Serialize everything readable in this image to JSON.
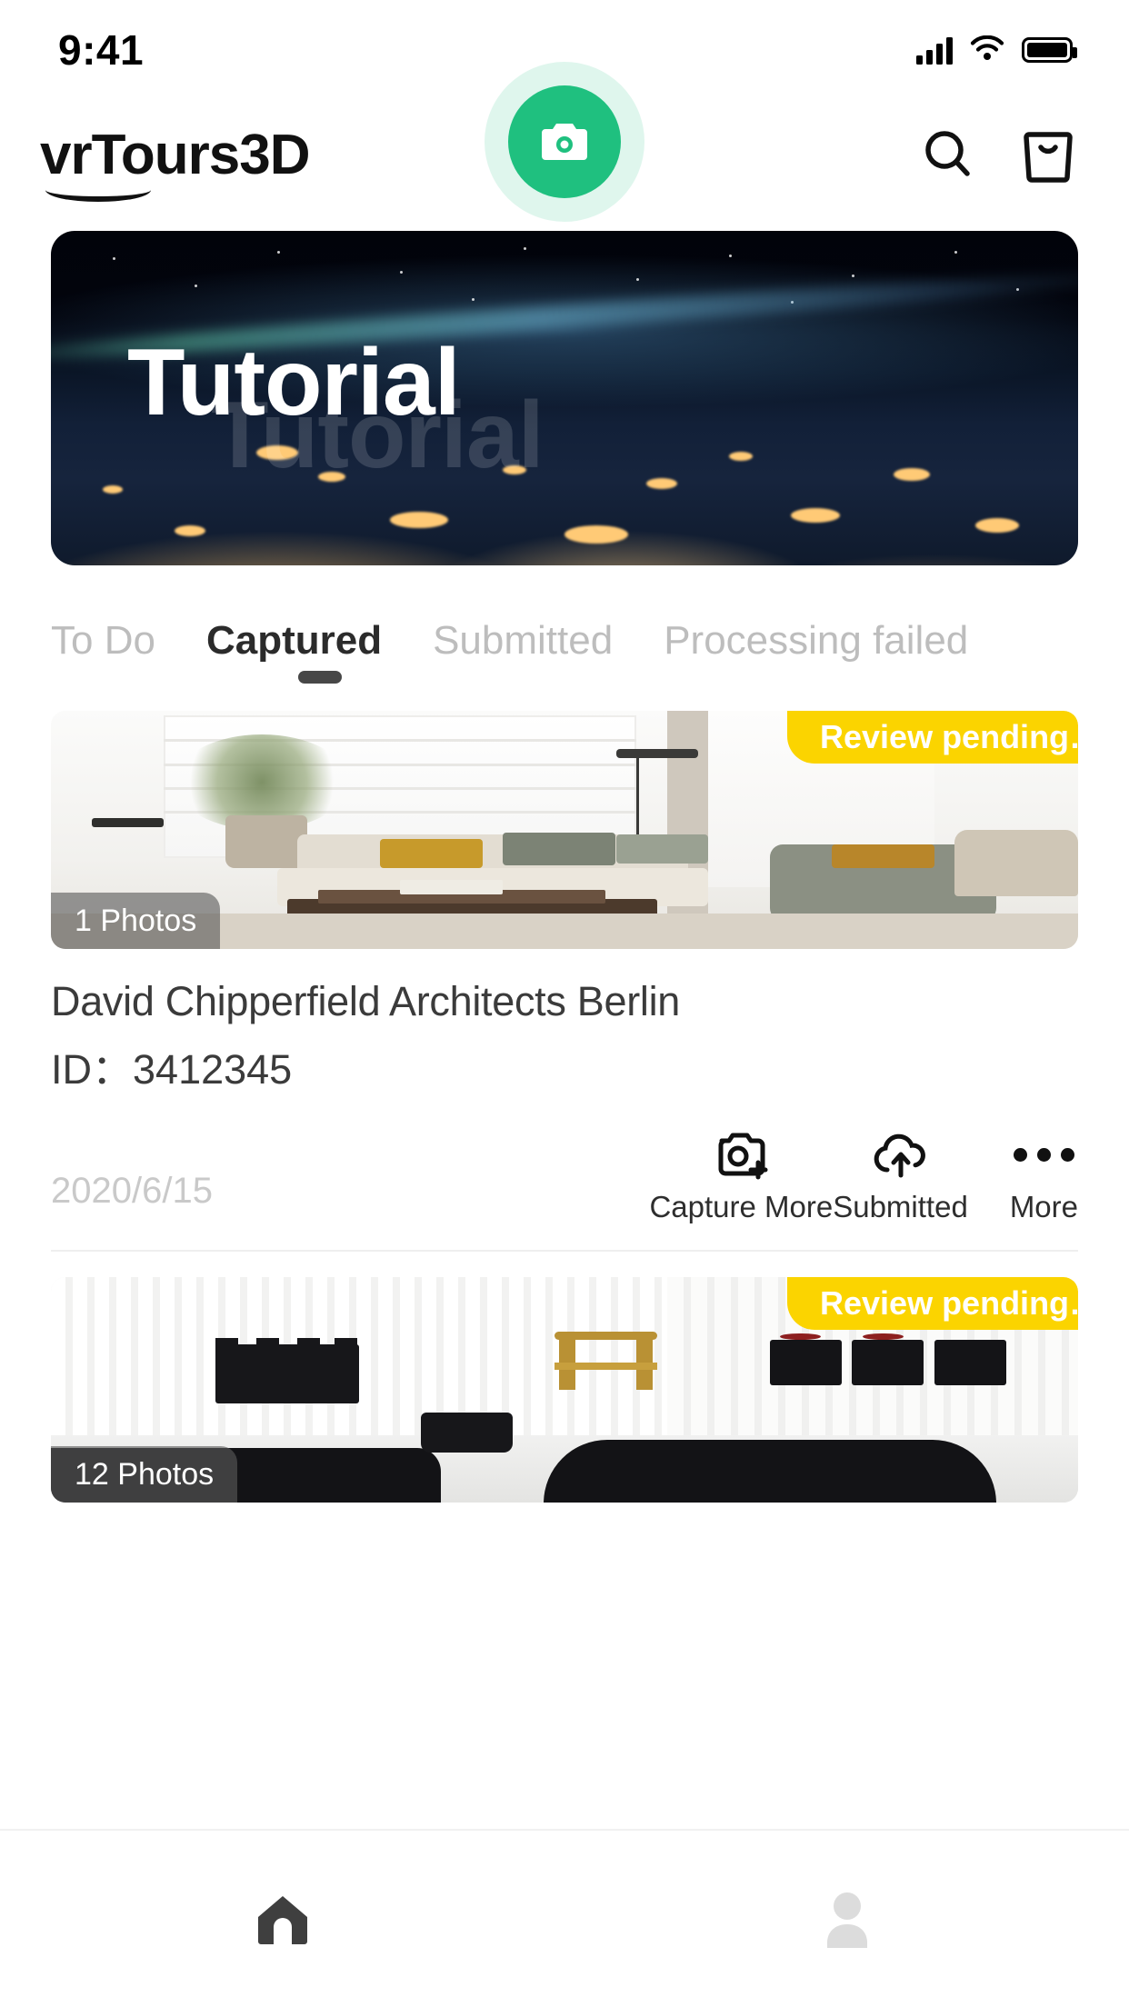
{
  "status_bar": {
    "time": "9:41",
    "signal_icon": "cellular-signal-icon",
    "wifi_icon": "wifi-icon",
    "battery_icon": "battery-icon"
  },
  "header": {
    "logo_text": "vrTours3D",
    "search_icon": "search-icon",
    "bag_icon": "shopping-bag-icon"
  },
  "banner": {
    "title": "Tutorial",
    "ghost_title": "Tutorial"
  },
  "tabs": [
    {
      "label": "To Do",
      "active": false
    },
    {
      "label": "Captured",
      "active": true
    },
    {
      "label": "Submitted",
      "active": false
    },
    {
      "label": "Processing failed",
      "active": false
    }
  ],
  "cards": [
    {
      "badge": "Review pending…",
      "photos": "1 Photos",
      "title": "David Chipperfield Architects Berlin",
      "id_label": "ID：",
      "id_value": "3412345",
      "date": "2020/6/15",
      "actions": [
        {
          "label": "Capture More",
          "icon": "camera-plus-icon"
        },
        {
          "label": "Submitted",
          "icon": "cloud-upload-icon"
        },
        {
          "label": "More",
          "icon": "ellipsis-icon"
        }
      ]
    },
    {
      "badge": "Review pending…",
      "photos": "12 Photos"
    }
  ],
  "bottom_nav": {
    "home_icon": "home-icon",
    "profile_icon": "profile-icon",
    "fab_icon": "camera-icon"
  },
  "colors": {
    "accent_green": "#1fc07f",
    "badge_yellow": "#fbd400",
    "active_tab": "#2b2b2b",
    "inactive_tab": "#bdbdbd"
  }
}
